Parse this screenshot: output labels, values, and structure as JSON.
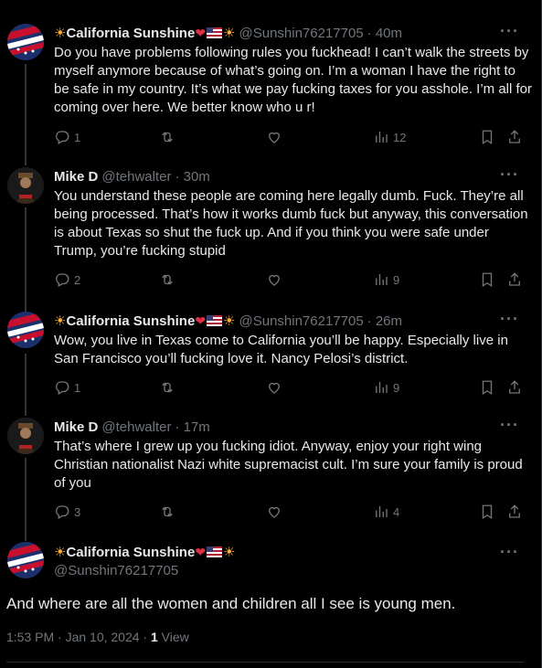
{
  "tweets": [
    {
      "name": "California Sunshine",
      "handle": "@Sunshin76217705",
      "time": "· 40m",
      "text": "Do you have problems following rules you fuckhead! I can’t walk the streets by myself anymore because of what’s going on. I’m a woman I have the right to be safe in my country. It’s what we pay fucking taxes for you asshole. I’m all for coming over here. We better know who u r!",
      "replies": "1",
      "reposts": "",
      "likes": "",
      "views": "12"
    },
    {
      "name": "Mike D",
      "handle": "@tehwalter",
      "time": "· 30m",
      "text": "You understand these people are coming here legally dumb. Fuck. They’re all being processed. That’s how it works dumb fuck but anyway, this conversation is about Texas so shut the fuck up. And if you think you were safe under Trump, you’re fucking stupid",
      "replies": "2",
      "reposts": "",
      "likes": "",
      "views": "9"
    },
    {
      "name": "California Sunshine",
      "handle": "@Sunshin76217705",
      "time": "· 26m",
      "text": "Wow, you live in Texas come to California you’ll be happy. Especially live in San Francisco you’ll fucking love it. Nancy Pelosi’s district.",
      "replies": "1",
      "reposts": "",
      "likes": "",
      "views": "9"
    },
    {
      "name": "Mike D",
      "handle": "@tehwalter",
      "time": "· 17m",
      "text": "That’s where I grew up you fucking idiot. Anyway, enjoy your right wing Christian nationalist Nazi white supremacist cult.  I’m sure your family is proud of you",
      "replies": "3",
      "reposts": "",
      "likes": "",
      "views": "4"
    }
  ],
  "main_tweet": {
    "name": "California Sunshine",
    "handle": "@Sunshin76217705",
    "text": "And where are all the women and children all I see is young men.",
    "timestamp": "1:53 PM · Jan 10, 2024 · ",
    "views_count": "1",
    "views_label": " View"
  },
  "icons": {
    "reply": "reply-icon",
    "repost": "repost-icon",
    "like": "like-icon",
    "views": "views-icon",
    "bookmark": "bookmark-icon",
    "share": "share-icon",
    "more": "more-icon"
  },
  "colors": {
    "background": "#000000",
    "text": "#e7e9ea",
    "muted": "#71767b",
    "divider": "#2f3336",
    "heart": "#dd2e44",
    "sun": "#ffac33"
  }
}
